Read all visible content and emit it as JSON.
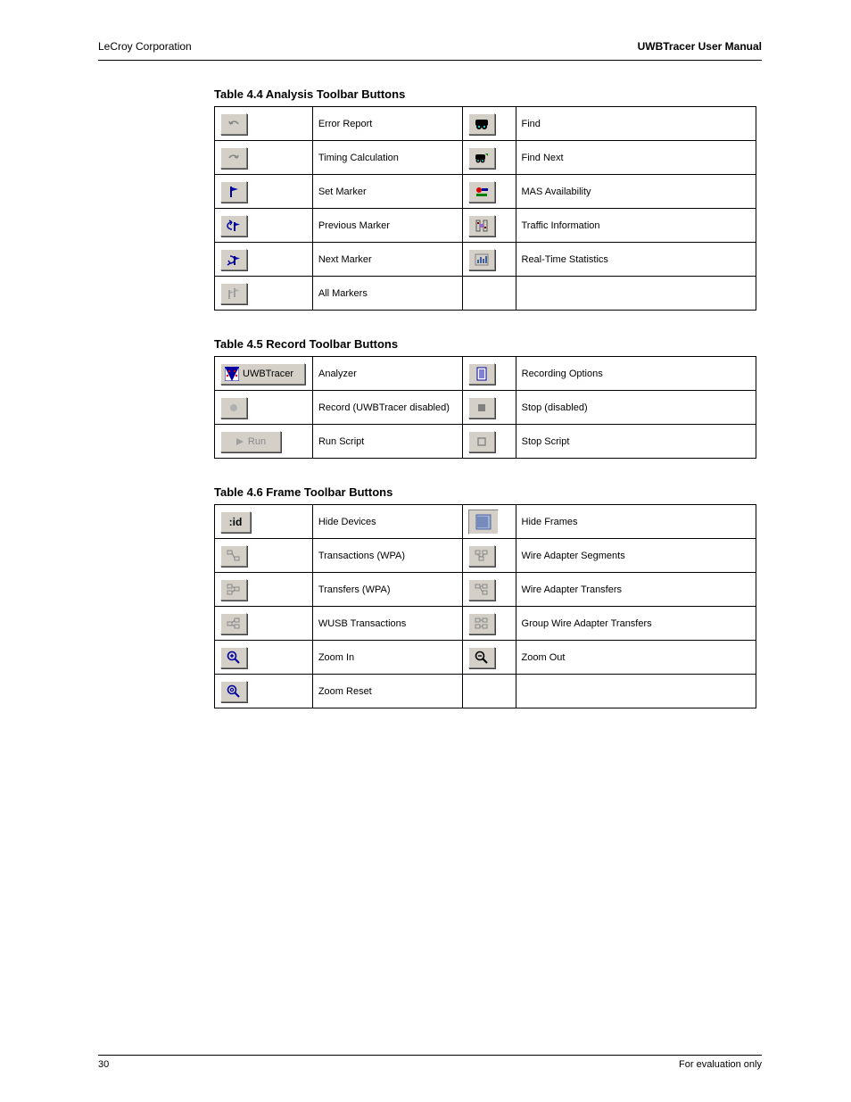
{
  "header": {
    "company": "LeCroy Corporation",
    "product": "UWBTracer User Manual"
  },
  "section1": {
    "title": "Table 4.4 Analysis Toolbar Buttons",
    "rows": [
      {
        "left_icon": "undo-icon",
        "left_desc": "Error Report",
        "right_icon": "binoculars-icon",
        "right_desc": "Find"
      },
      {
        "left_icon": "redo-icon",
        "left_desc": "Timing Calculation",
        "right_icon": "find-next-icon",
        "right_desc": "Find Next"
      },
      {
        "left_icon": "blue-flag-icon",
        "left_desc": "Set Marker",
        "right_icon": "mas-assign-icon",
        "right_desc": "MAS Availability"
      },
      {
        "left_icon": "prev-marker-icon",
        "left_desc": "Previous Marker",
        "right_icon": "traffic-info-icon",
        "right_desc": "Traffic Information"
      },
      {
        "left_icon": "next-marker-icon",
        "left_desc": "Next Marker",
        "right_icon": "realtime-stats-icon",
        "right_desc": "Real-Time Statistics"
      },
      {
        "left_icon": "all-markers-icon",
        "left_desc": "All Markers",
        "right_icon": "",
        "right_desc": ""
      }
    ]
  },
  "section2": {
    "title": "Table 4.5 Record Toolbar Buttons",
    "rows": [
      {
        "left_icon": "uwbtracer-btn",
        "left_label": "UWBTracer",
        "left_desc": "Analyzer",
        "right_icon": "blue-sheet-icon",
        "right_desc": "Recording Options"
      },
      {
        "left_icon": "rec-disabled-icon",
        "left_desc": "Record (UWBTracer disabled)",
        "right_icon": "stop-disabled-icon",
        "right_desc": "Stop (disabled)"
      },
      {
        "left_icon": "run-btn",
        "left_label": "Run",
        "left_desc": "Run Script",
        "right_icon": "stop-script-icon",
        "right_desc": "Stop Script"
      }
    ]
  },
  "section3": {
    "title": "Table 4.6 Frame Toolbar Buttons",
    "rows": [
      {
        "left_icon": "id-icon",
        "left_desc": "Hide Devices",
        "right_icon": "hide-frames-icon",
        "right_desc": "Hide Frames"
      },
      {
        "left_icon": "wpa-icon",
        "left_desc": "Transactions (WPA)",
        "right_icon": "wire-adapter-icon",
        "right_desc": "Wire Adapter Segments"
      },
      {
        "left_icon": "wpa-transfer-icon",
        "left_desc": "Transfers (WPA)",
        "right_icon": "wire-adapter-transfer-icon",
        "right_desc": "Wire Adapter Transfers"
      },
      {
        "left_icon": "wusb-trans-icon",
        "left_desc": "WUSB Transactions",
        "right_icon": "group-transfer-icon",
        "right_desc": "Group Wire Adapter Transfers"
      },
      {
        "left_icon": "zoom-in-icon",
        "left_desc": "Zoom In",
        "right_icon": "zoom-out-icon",
        "right_desc": "Zoom Out"
      },
      {
        "left_icon": "zoom-reset-icon",
        "left_desc": "Zoom Reset",
        "right_icon": "",
        "right_desc": ""
      }
    ]
  },
  "footer": {
    "page": "30",
    "note": "For evaluation only"
  }
}
